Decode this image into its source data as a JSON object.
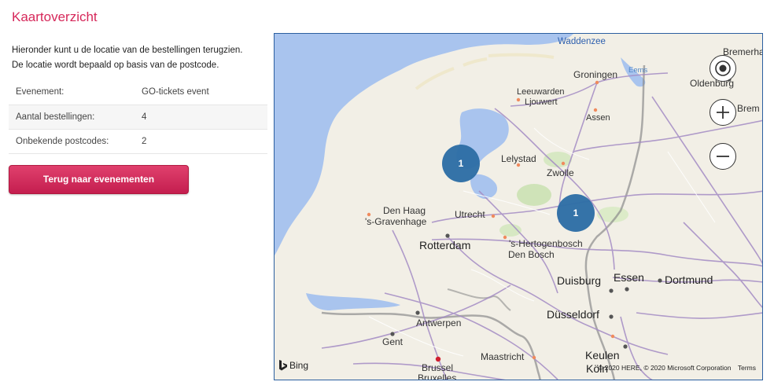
{
  "page": {
    "title": "Kaartoverzicht",
    "intro_line1": "Hieronder kunt u de locatie van de bestellingen terugzien.",
    "intro_line2": "De locatie wordt bepaald op basis van de postcode."
  },
  "info": {
    "rows": [
      {
        "label": "Evenement:",
        "value": "GO-tickets event"
      },
      {
        "label": "Aantal bestellingen:",
        "value": "4"
      },
      {
        "label": "Onbekende postcodes:",
        "value": "2"
      }
    ]
  },
  "actions": {
    "back_label": "Terug naar evenementen"
  },
  "map": {
    "sea_labels": {
      "waddenzee": "Waddenzee",
      "eems": "Eems"
    },
    "cities": {
      "groningen": "Groningen",
      "bremerhaven": "Bremerhave",
      "oldenburg": "Oldenburg",
      "bremen": "Brem",
      "leeuwarden": "Leeuwarden",
      "ljouwert": "Ljouwert",
      "assen": "Assen",
      "lelystad": "Lelystad",
      "zwolle": "Zwolle",
      "den_haag": "Den Haag",
      "s_gravenhage": "'s-Gravenhage",
      "utrecht": "Utrecht",
      "rotterdam": "Rotterdam",
      "s_hertogenbosch": "'s-Hertogenbosch",
      "den_bosch": "Den Bosch",
      "duisburg": "Duisburg",
      "essen": "Essen",
      "dortmund": "Dortmund",
      "antwerpen": "Antwerpen",
      "dusseldorf": "Düsseldorf",
      "gent": "Gent",
      "maastricht": "Maastricht",
      "keulen": "Keulen",
      "koln": "Köln",
      "brussel": "Brussel",
      "bruxelles": "Bruxelles"
    },
    "clusters": [
      {
        "count": "1"
      },
      {
        "count": "1"
      }
    ],
    "attribution": {
      "provider": "Bing",
      "copyright": "© 2020 HERE, © 2020 Microsoft Corporation",
      "terms": "Terms"
    },
    "colors": {
      "sea": "#a9c4ee",
      "land": "#f2efe6",
      "roads": "#a48cc4",
      "cluster": "#2f6fa6"
    }
  }
}
